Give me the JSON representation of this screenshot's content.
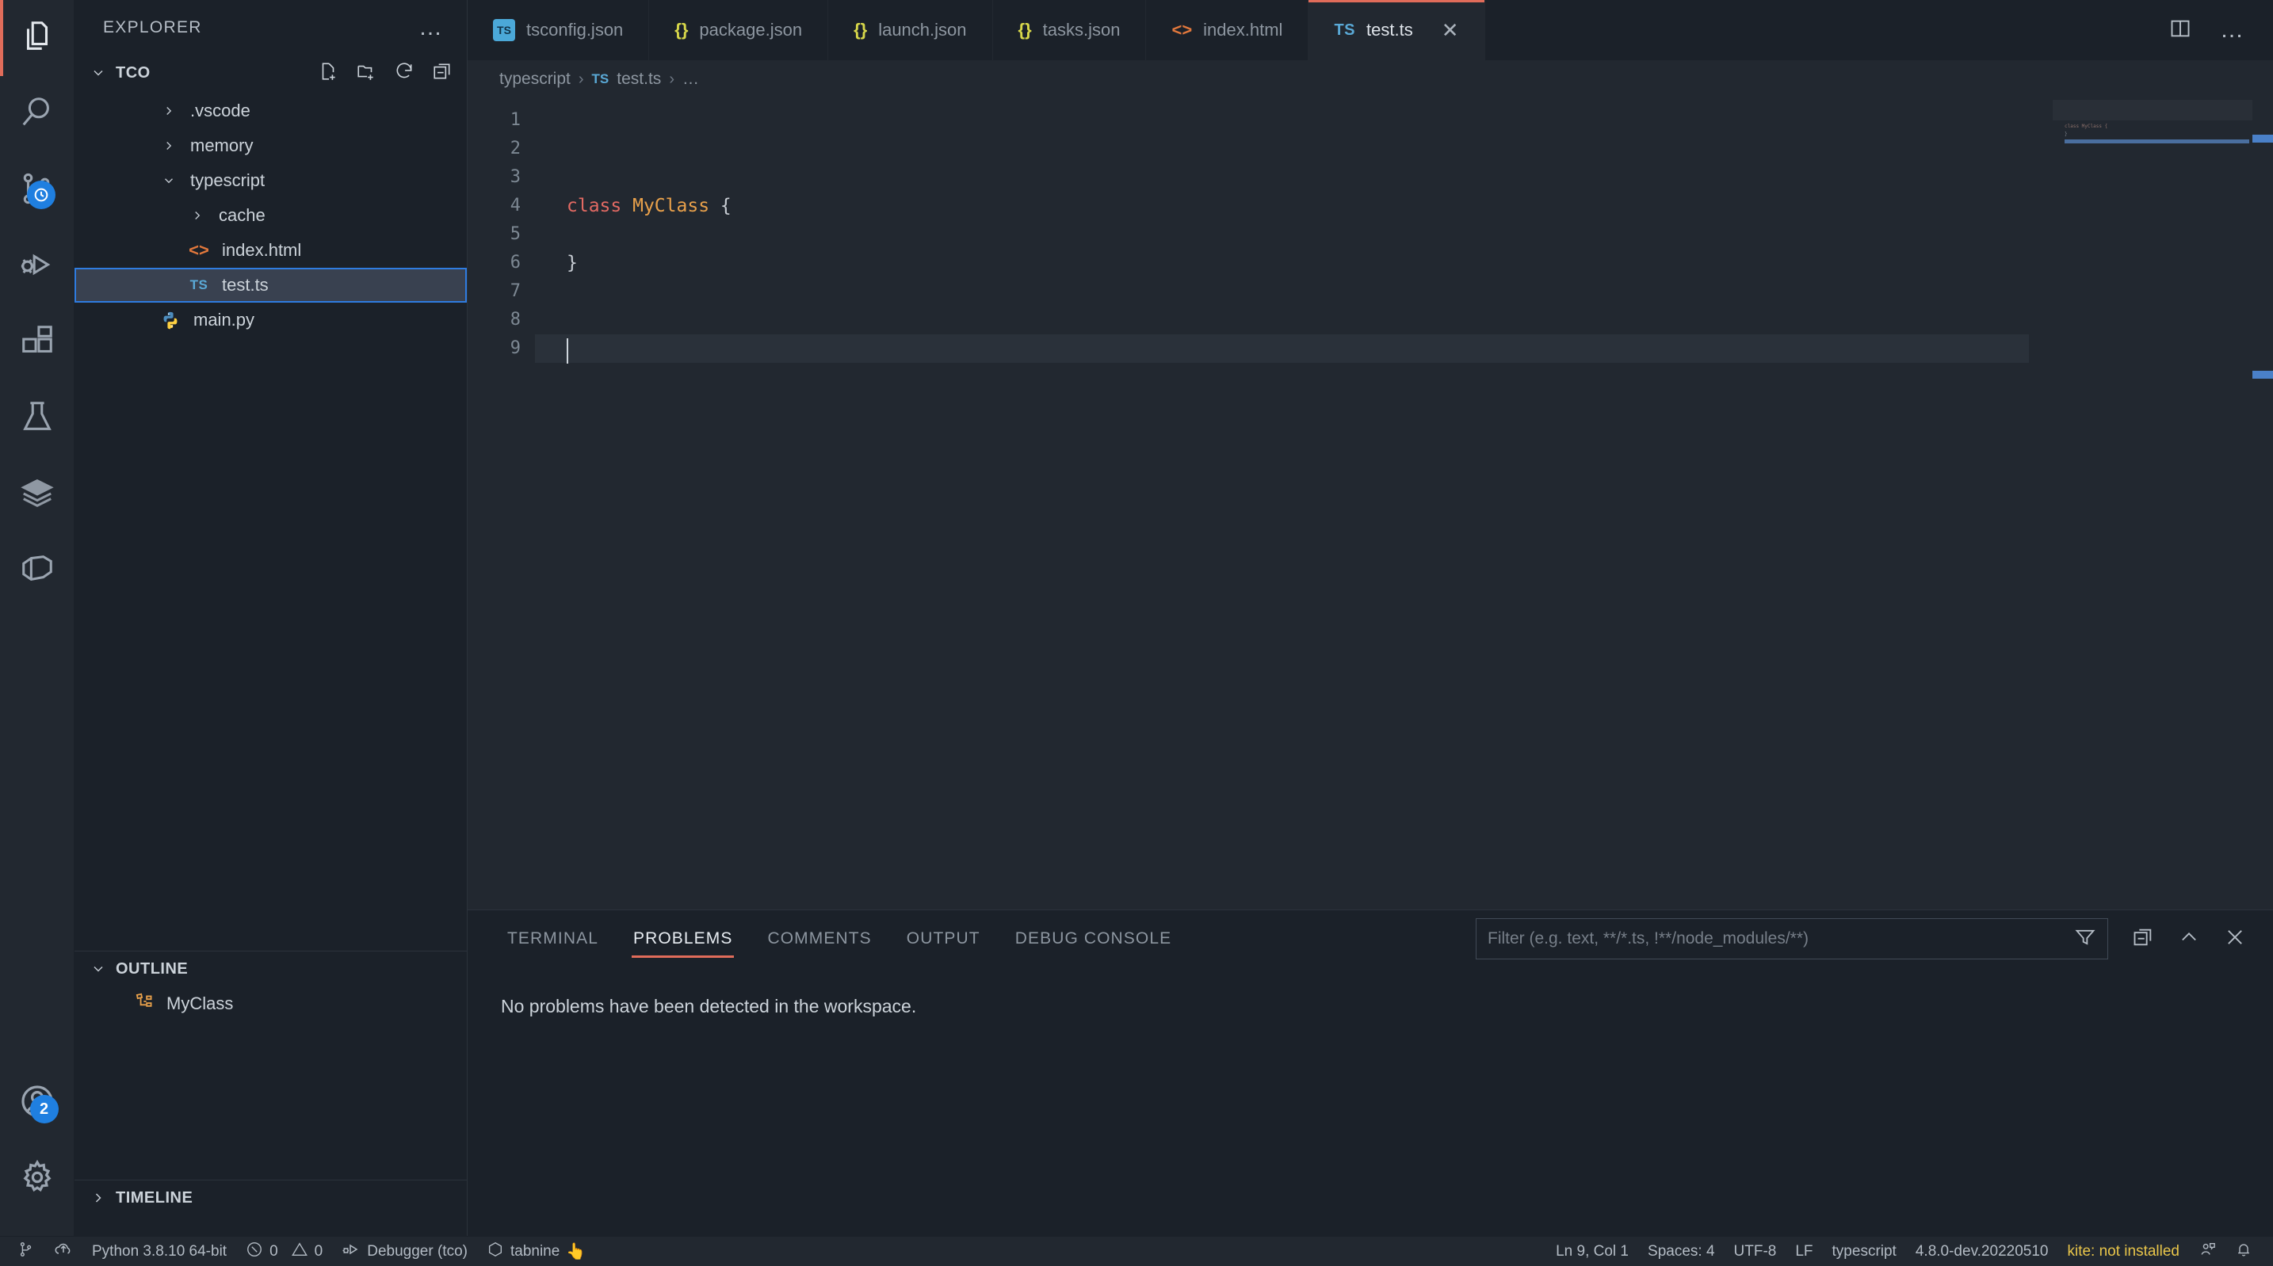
{
  "activitybar": {
    "items": [
      {
        "name": "explorer",
        "icon": "files-icon",
        "active": true,
        "badge": null
      },
      {
        "name": "search",
        "icon": "search-icon",
        "active": false,
        "badge": null
      },
      {
        "name": "source-control",
        "icon": "source-control-icon",
        "active": false,
        "badge": "clock"
      },
      {
        "name": "run-and-debug",
        "icon": "run-debug-icon",
        "active": false,
        "badge": null
      },
      {
        "name": "extensions",
        "icon": "extensions-icon",
        "active": false,
        "badge": null
      },
      {
        "name": "testing",
        "icon": "beaker-icon",
        "active": false,
        "badge": null
      },
      {
        "name": "remote-explorer",
        "icon": "layers-icon",
        "active": false,
        "badge": null
      },
      {
        "name": "docker",
        "icon": "docker-icon",
        "active": false,
        "badge": null
      }
    ],
    "bottom": [
      {
        "name": "accounts",
        "icon": "account-icon",
        "badge": "2"
      },
      {
        "name": "manage",
        "icon": "gear-icon",
        "badge": null
      }
    ]
  },
  "sidebar": {
    "title": "EXPLORER",
    "more_actions": "…",
    "explorer": {
      "title": "TCO",
      "expanded": true,
      "actions": [
        "new-file-icon",
        "new-folder-icon",
        "refresh-icon",
        "collapse-all-icon"
      ],
      "items": [
        {
          "label": ".vscode",
          "type": "folder",
          "depth": 1,
          "expanded": false,
          "icon": "chevron-right-icon",
          "selected": false
        },
        {
          "label": "memory",
          "type": "folder",
          "depth": 1,
          "expanded": false,
          "icon": "chevron-right-icon",
          "selected": false
        },
        {
          "label": "typescript",
          "type": "folder",
          "depth": 1,
          "expanded": true,
          "icon": "chevron-down-icon",
          "selected": false
        },
        {
          "label": "cache",
          "type": "folder",
          "depth": 2,
          "expanded": false,
          "icon": "chevron-right-icon",
          "selected": false
        },
        {
          "label": "index.html",
          "type": "file",
          "depth": 2,
          "icon": "html-icon",
          "selected": false
        },
        {
          "label": "test.ts",
          "type": "file",
          "depth": 2,
          "icon": "ts-icon",
          "selected": true
        },
        {
          "label": "main.py",
          "type": "file",
          "depth": 1,
          "icon": "python-icon",
          "selected": false
        }
      ]
    },
    "outline": {
      "title": "OUTLINE",
      "expanded": true,
      "items": [
        {
          "label": "MyClass",
          "icon": "symbol-class-icon"
        }
      ]
    },
    "timeline": {
      "title": "TIMELINE",
      "expanded": false
    }
  },
  "editor": {
    "tabs": [
      {
        "label": "tsconfig.json",
        "icon": "tsconfig-icon",
        "active": false,
        "closable": false
      },
      {
        "label": "package.json",
        "icon": "json-icon",
        "active": false,
        "closable": false
      },
      {
        "label": "launch.json",
        "icon": "json-icon",
        "active": false,
        "closable": false
      },
      {
        "label": "tasks.json",
        "icon": "json-icon",
        "active": false,
        "closable": false
      },
      {
        "label": "index.html",
        "icon": "html-icon",
        "active": false,
        "closable": false
      },
      {
        "label": "test.ts",
        "icon": "ts-icon",
        "active": true,
        "closable": true,
        "close_label": "✕"
      }
    ],
    "tabbar_actions": [
      "split-editor-icon",
      "more-actions-icon"
    ],
    "breadcrumb": [
      {
        "label": "typescript",
        "icon": null
      },
      {
        "label": "test.ts",
        "icon": "ts-icon"
      },
      {
        "label": "…",
        "icon": null
      }
    ],
    "breadcrumb_separator": "›",
    "line_numbers": [
      "1",
      "2",
      "3",
      "4",
      "5",
      "6",
      "7",
      "8",
      "9"
    ],
    "code_lines": [
      {
        "n": 1,
        "tokens": []
      },
      {
        "n": 2,
        "tokens": []
      },
      {
        "n": 3,
        "tokens": []
      },
      {
        "n": 4,
        "tokens": [
          {
            "t": "class",
            "c": "kw"
          },
          {
            "t": " ",
            "c": "punc"
          },
          {
            "t": "MyClass",
            "c": "type"
          },
          {
            "t": " {",
            "c": "punc"
          }
        ]
      },
      {
        "n": 5,
        "tokens": []
      },
      {
        "n": 6,
        "tokens": [
          {
            "t": "}",
            "c": "punc"
          }
        ]
      },
      {
        "n": 7,
        "tokens": []
      },
      {
        "n": 8,
        "tokens": []
      },
      {
        "n": 9,
        "tokens": [],
        "current": true
      }
    ],
    "minimap_text": [
      "class MyClass {",
      "}"
    ]
  },
  "panel": {
    "tabs": [
      {
        "label": "TERMINAL",
        "active": false
      },
      {
        "label": "PROBLEMS",
        "active": true
      },
      {
        "label": "COMMENTS",
        "active": false
      },
      {
        "label": "OUTPUT",
        "active": false
      },
      {
        "label": "DEBUG CONSOLE",
        "active": false
      }
    ],
    "filter_placeholder": "Filter (e.g. text, **/*.ts, !**/node_modules/**)",
    "filter_value": "",
    "actions": [
      "filter-icon",
      "clear-icon",
      "maximize-panel-icon",
      "close-panel-icon"
    ],
    "message": "No problems have been detected in the workspace."
  },
  "statusbar": {
    "left": [
      {
        "name": "remote-indicator",
        "icon": "remote-icon",
        "label": ""
      },
      {
        "name": "sync-changes",
        "icon": "cloud-upload-icon",
        "label": ""
      },
      {
        "name": "python-interpreter",
        "icon": null,
        "label": "Python 3.8.10 64-bit"
      },
      {
        "name": "problems-count",
        "icon": "error-warning-icon",
        "label": "0",
        "label2": "0"
      },
      {
        "name": "debugger",
        "icon": "debug-alt-icon",
        "label": "Debugger (tco)"
      },
      {
        "name": "tabnine",
        "icon": "tabnine-icon",
        "label": "tabnine",
        "emoji": "👆"
      }
    ],
    "right": [
      {
        "name": "cursor-position",
        "label": "Ln 9, Col 1"
      },
      {
        "name": "indentation",
        "label": "Spaces: 4"
      },
      {
        "name": "encoding",
        "label": "UTF-8"
      },
      {
        "name": "eol",
        "label": "LF"
      },
      {
        "name": "language-mode",
        "label": "typescript"
      },
      {
        "name": "typescript-version",
        "label": "4.8.0-dev.20220510"
      },
      {
        "name": "kite-status",
        "label": "kite: not installed",
        "warn": true
      },
      {
        "name": "feedback",
        "icon": "feedback-icon",
        "label": ""
      },
      {
        "name": "notifications",
        "icon": "bell-icon",
        "label": ""
      }
    ]
  },
  "colors": {
    "accent_active": "#e06c5a",
    "badge_blue": "#1f7fe0",
    "selection_border": "#2f7ce0",
    "editor_bg": "#222830",
    "sidebar_bg": "#1b2129",
    "keyword": "#e36a63",
    "type": "#e9a14b",
    "warn_yellow": "#e8c54a"
  }
}
